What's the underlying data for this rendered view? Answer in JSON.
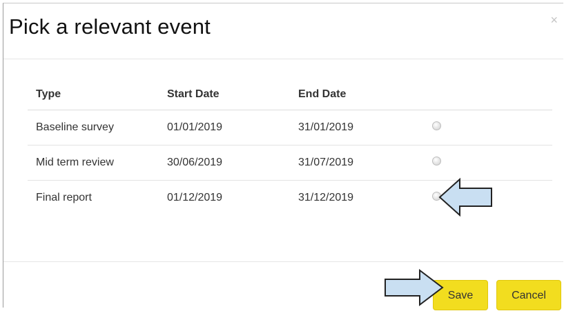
{
  "dialog": {
    "title": "Pick a relevant event",
    "close_glyph": "×"
  },
  "table": {
    "headers": {
      "type": "Type",
      "start_date": "Start Date",
      "end_date": "End Date"
    },
    "rows": [
      {
        "type": "Baseline survey",
        "start_date": "01/01/2019",
        "end_date": "31/01/2019",
        "selected": false
      },
      {
        "type": "Mid term review",
        "start_date": "30/06/2019",
        "end_date": "31/07/2019",
        "selected": false
      },
      {
        "type": "Final report",
        "start_date": "01/12/2019",
        "end_date": "31/12/2019",
        "selected": false
      }
    ]
  },
  "footer": {
    "save_label": "Save",
    "cancel_label": "Cancel"
  },
  "annotations": {
    "arrow_icon": "arrow-icon",
    "arrow_fill": "#c9dff2",
    "arrow_stroke": "#222222"
  },
  "colors": {
    "button": "#f2dd1f"
  }
}
